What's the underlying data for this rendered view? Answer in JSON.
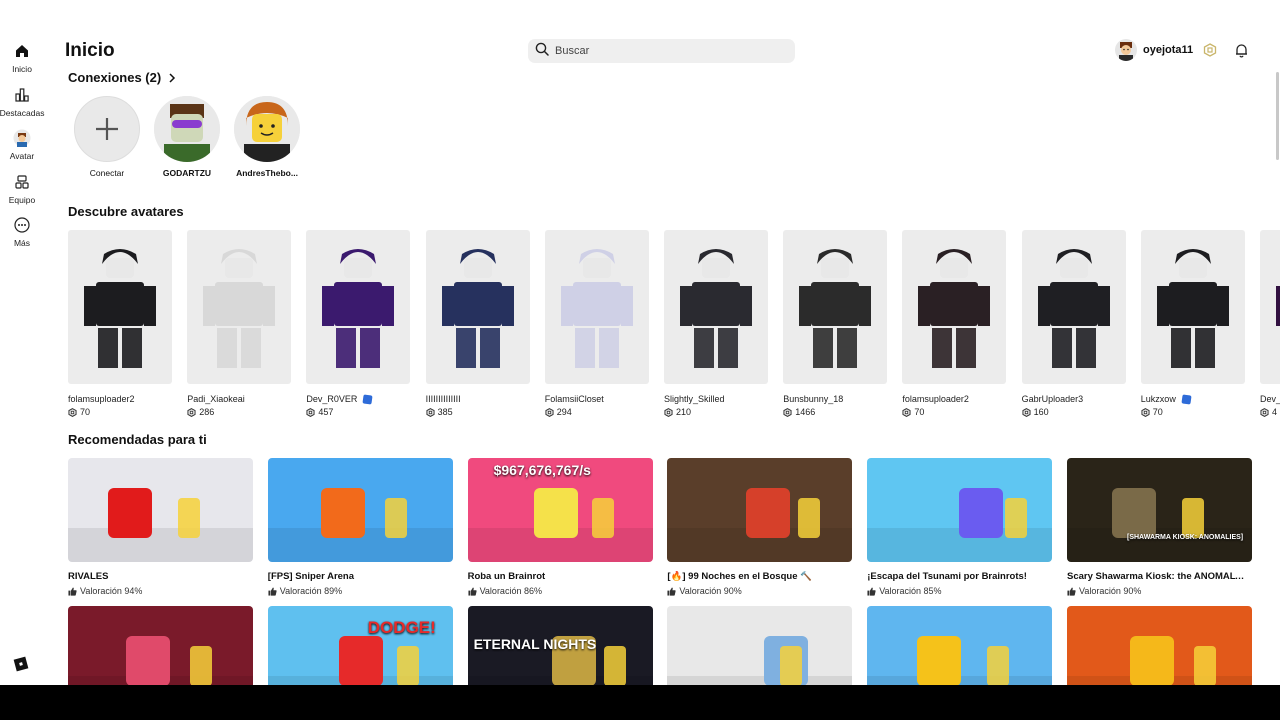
{
  "sidebar": {
    "items": [
      {
        "label": "Inicio",
        "icon": "home-icon"
      },
      {
        "label": "Destacadas",
        "icon": "charts-icon"
      },
      {
        "label": "Avatar",
        "icon": "avatar-icon"
      },
      {
        "label": "Equipo",
        "icon": "team-icon"
      },
      {
        "label": "Más",
        "icon": "more-icon"
      }
    ]
  },
  "header": {
    "title": "Inicio",
    "search_placeholder": "Buscar",
    "username": "oyejota11"
  },
  "connections": {
    "title": "Conexiones (2)",
    "items": [
      {
        "name": "Conectar"
      },
      {
        "name": "GODARTZU"
      },
      {
        "name": "AndresThebo..."
      }
    ]
  },
  "discover": {
    "title": "Descubre avatares",
    "items": [
      {
        "name": "folamsuploader2",
        "cost": "70",
        "verified": false,
        "color": "#1c1c1f"
      },
      {
        "name": "Padi_Xiaokeai",
        "cost": "286",
        "verified": false,
        "color": "#d8d8d8"
      },
      {
        "name": "Dev_R0VER",
        "cost": "457",
        "verified": true,
        "color": "#3b1a6e"
      },
      {
        "name": "IIIIIIIIIIIIII",
        "cost": "385",
        "verified": false,
        "color": "#26315e"
      },
      {
        "name": "FolamsiiCloset",
        "cost": "294",
        "verified": false,
        "color": "#cfd0e6"
      },
      {
        "name": "Slightly_Skilled",
        "cost": "210",
        "verified": false,
        "color": "#2a2a30"
      },
      {
        "name": "Bunsbunny_18",
        "cost": "1466",
        "verified": false,
        "color": "#2b2b2b"
      },
      {
        "name": "folamsuploader2",
        "cost": "70",
        "verified": false,
        "color": "#2a2024"
      },
      {
        "name": "GabrUploader3",
        "cost": "160",
        "verified": false,
        "color": "#1f1f23"
      },
      {
        "name": "Lukzxow",
        "cost": "70",
        "verified": true,
        "color": "#1d1d20"
      },
      {
        "name": "Dev_",
        "cost": "4",
        "verified": false,
        "color": "#311040"
      }
    ]
  },
  "recommended": {
    "title": "Recomendadas para ti",
    "items": [
      {
        "title": "RIVALES",
        "rating": "Valoración 94%",
        "bg": "#e7e7ec",
        "accent": "#e11b1b"
      },
      {
        "title": "[FPS] Sniper Arena",
        "rating": "Valoración 89%",
        "bg": "#49a8ef",
        "accent": "#f26a1b"
      },
      {
        "title": "Roba un Brainrot",
        "rating": "Valoración 86%",
        "bg": "#f04a7e",
        "accent": "#f5e14a",
        "overlay": "$967,676,767/s"
      },
      {
        "title": "[🔥] 99 Noches en el Bosque 🔨",
        "rating": "Valoración 90%",
        "bg": "#5a3e2a",
        "accent": "#d6402a"
      },
      {
        "title": "¡Escapa del Tsunami por Brainrots!",
        "rating": "Valoración 85%",
        "bg": "#5fc6f2",
        "accent": "#6a5cf0"
      },
      {
        "title": "Scary Shawarma Kiosk: the ANOMALY ...",
        "rating": "Valoración 90%",
        "bg": "#2a2418",
        "accent": "#7a6a48",
        "overlay": "[SHAWARMA KIOSK: ANOMALIES]"
      },
      {
        "title": "",
        "rating": "",
        "bg": "#7a1a2a",
        "accent": "#e04a6a"
      },
      {
        "title": "",
        "rating": "",
        "bg": "#5fc0ef",
        "accent": "#e62a2a",
        "overlay": "DODGE!"
      },
      {
        "title": "",
        "rating": "",
        "bg": "#1a1a24",
        "accent": "#c0a040",
        "overlay": "ETERNAL NIGHTS"
      },
      {
        "title": "",
        "rating": "",
        "bg": "#e8e8e8",
        "accent": "#7fb0e0"
      },
      {
        "title": "",
        "rating": "",
        "bg": "#5fb6ef",
        "accent": "#f5c21a"
      },
      {
        "title": "",
        "rating": "",
        "bg": "#e2591a",
        "accent": "#f5b81a"
      }
    ]
  }
}
